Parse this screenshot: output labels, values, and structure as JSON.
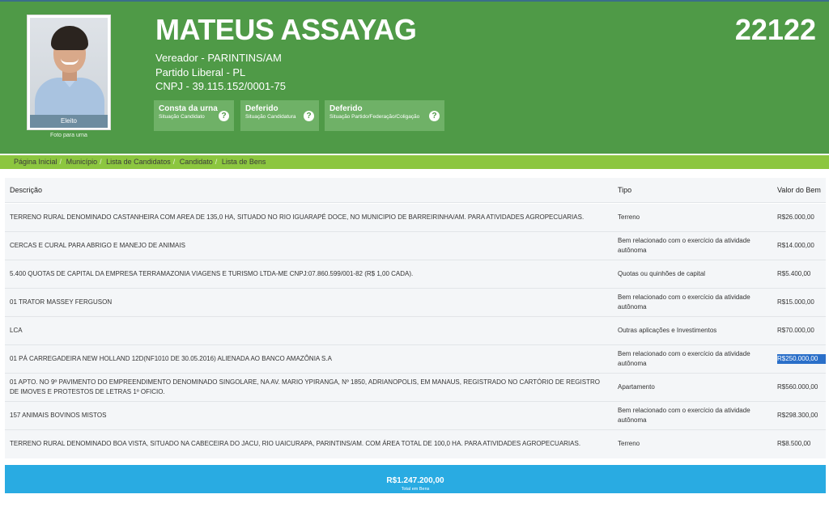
{
  "candidate": {
    "name": "MATEUS ASSAYAG",
    "number": "22122",
    "role": "Vereador - PARINTINS/AM",
    "party": "Partido Liberal - PL",
    "cnpj": "CNPJ - 39.115.152/0001-75",
    "photo_status": "Eleito",
    "photo_caption": "Foto para urna"
  },
  "statuses": [
    {
      "title": "Consta da urna",
      "subtitle": "Situação Candidato",
      "icon": "question-icon"
    },
    {
      "title": "Deferido",
      "subtitle": "Situação Candidatura",
      "icon": "question-icon"
    },
    {
      "title": "Deferido",
      "subtitle": "Situação Partido/Federação/Coligação",
      "icon": "question-icon"
    }
  ],
  "breadcrumb": [
    "Página Inicial",
    "Município",
    "Lista de Candidatos",
    "Candidato",
    "Lista de Bens"
  ],
  "table": {
    "headers": {
      "descricao": "Descrição",
      "tipo": "Tipo",
      "valor": "Valor do Bem"
    },
    "rows": [
      {
        "descricao": "TERRENO RURAL DENOMINADO CASTANHEIRA COM AREA DE 135,0 HA, SITUADO NO RIO IGUARAPÉ DOCE, NO MUNICIPIO DE BARREIRINHA/AM. PARA ATIVIDADES AGROPECUARIAS.",
        "tipo": "Terreno",
        "valor": "R$26.000,00"
      },
      {
        "descricao": "CERCAS E CURAL PARA ABRIGO E MANEJO DE ANIMAIS",
        "tipo": "Bem relacionado com o exercício da atividade autônoma",
        "valor": "R$14.000,00"
      },
      {
        "descricao": "5.400 QUOTAS DE CAPITAL DA EMPRESA TERRAMAZONIA VIAGENS E TURISMO LTDA-ME CNPJ:07.860.599/001-82 (R$ 1,00 CADA).",
        "tipo": "Quotas ou quinhões de capital",
        "valor": "R$5.400,00"
      },
      {
        "descricao": "01 TRATOR MASSEY FERGUSON",
        "tipo": "Bem relacionado com o exercício da atividade autônoma",
        "valor": "R$15.000,00"
      },
      {
        "descricao": "LCA",
        "tipo": "Outras aplicações e Investimentos",
        "valor": "R$70.000,00"
      },
      {
        "descricao": "01 PÁ CARREGADEIRA NEW HOLLAND 12D(NF1010 DE 30.05.2016) ALIENADA AO BANCO AMAZÔNIA S.A",
        "tipo": "Bem relacionado com o exercício da atividade autônoma",
        "valor": "R$250.000,00"
      },
      {
        "descricao": "01 APTO. NO 9º PAVIMENTO DO EMPREENDIMENTO DENOMINADO SINGOLARE, NA AV. MARIO YPIRANGA, Nº 1850, ADRIANOPOLIS, EM MANAUS, REGISTRADO NO CARTÓRIO DE REGISTRO DE IMOVES E PROTESTOS DE LETRAS 1º OFICIO.",
        "tipo": "Apartamento",
        "valor": "R$560.000,00"
      },
      {
        "descricao": "157 ANIMAIS BOVINOS MISTOS",
        "tipo": "Bem relacionado com o exercício da atividade autônoma",
        "valor": "R$298.300,00"
      },
      {
        "descricao": "TERRENO RURAL DENOMINADO BOA VISTA, SITUADO NA CABECEIRA DO JACU, RIO UAICURAPA, PARINTINS/AM. COM ÁREA TOTAL DE 100,0 HA. PARA ATIVIDADES AGROPECUARIAS.",
        "tipo": "Terreno",
        "valor": "R$8.500,00"
      }
    ]
  },
  "total": {
    "value": "R$1.247.200,00",
    "label": "Total em Bens"
  },
  "colors": {
    "header": "#4f9a47",
    "breadcrumb": "#8cc63f",
    "total": "#29abe2"
  }
}
